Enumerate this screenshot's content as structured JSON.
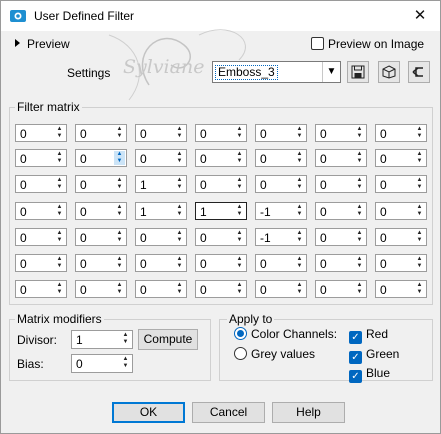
{
  "window": {
    "title": "User Defined Filter",
    "close_glyph": "✕"
  },
  "preview": {
    "label": "Preview",
    "on_image_label": "Preview on Image",
    "on_image_checked": false
  },
  "settings": {
    "label": "Settings",
    "value": "Emboss_3",
    "buttons": [
      "save-icon",
      "load-icon",
      "reset-icon"
    ]
  },
  "matrix": {
    "title": "Filter matrix",
    "rows": [
      [
        "0",
        "0",
        "0",
        "0",
        "0",
        "0",
        "0"
      ],
      [
        "0",
        "0",
        "0",
        "0",
        "0",
        "0",
        "0"
      ],
      [
        "0",
        "0",
        "1",
        "0",
        "0",
        "0",
        "0"
      ],
      [
        "0",
        "0",
        "1",
        "1",
        "-1",
        "0",
        "0"
      ],
      [
        "0",
        "0",
        "0",
        "0",
        "-1",
        "0",
        "0"
      ],
      [
        "0",
        "0",
        "0",
        "0",
        "0",
        "0",
        "0"
      ],
      [
        "0",
        "0",
        "0",
        "0",
        "0",
        "0",
        "0"
      ]
    ]
  },
  "modifiers": {
    "title": "Matrix modifiers",
    "divisor_label": "Divisor:",
    "divisor": "1",
    "compute_label": "Compute",
    "bias_label": "Bias:",
    "bias": "0"
  },
  "apply": {
    "title": "Apply to",
    "color_channels_label": "Color Channels:",
    "grey_label": "Grey values",
    "mode": "color",
    "red_label": "Red",
    "green_label": "Green",
    "blue_label": "Blue",
    "red": true,
    "green": true,
    "blue": true
  },
  "buttons": {
    "ok": "OK",
    "cancel": "Cancel",
    "help": "Help"
  },
  "watermark": "Sylviane",
  "colors": {
    "accent": "#0067c0",
    "icon": "#1e8fd1"
  }
}
